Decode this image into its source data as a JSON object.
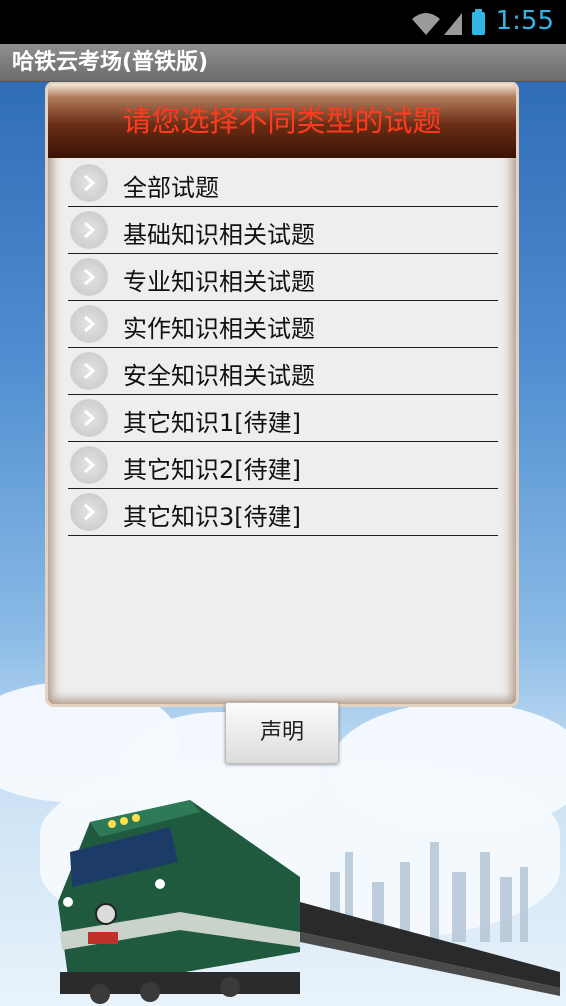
{
  "status_bar": {
    "time": "1:55"
  },
  "app_title": "哈铁云考场(普铁版)",
  "panel": {
    "header": "请您选择不同类型的试题",
    "items": [
      {
        "label": "全部试题"
      },
      {
        "label": "基础知识相关试题"
      },
      {
        "label": "专业知识相关试题"
      },
      {
        "label": "实作知识相关试题"
      },
      {
        "label": "安全知识相关试题"
      },
      {
        "label": "其它知识1[待建]"
      },
      {
        "label": "其它知识2[待建]"
      },
      {
        "label": "其它知识3[待建]"
      }
    ]
  },
  "declaration_button": "声明",
  "colors": {
    "header_text": "#ff3b1f",
    "clock": "#33b5e5"
  }
}
